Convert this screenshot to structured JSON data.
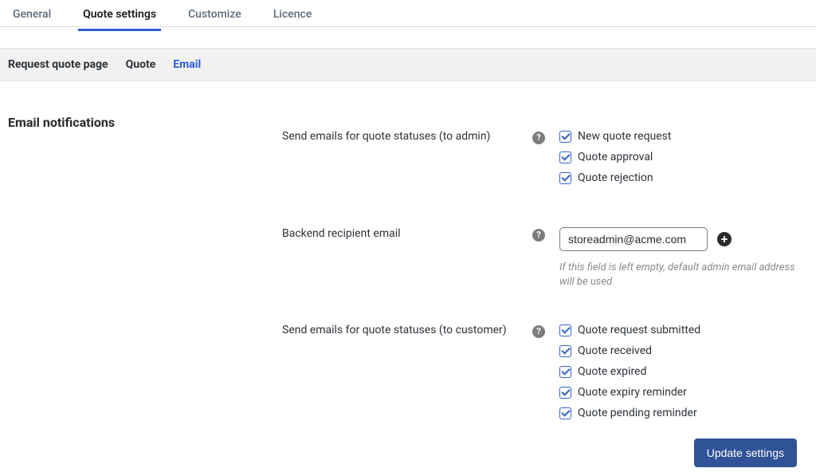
{
  "topTabs": {
    "general": "General",
    "quoteSettings": "Quote settings",
    "customize": "Customize",
    "licence": "Licence"
  },
  "subTabs": {
    "requestQuotePage": "Request quote page",
    "quote": "Quote",
    "email": "Email"
  },
  "section": {
    "title": "Email notifications"
  },
  "fields": {
    "adminEmails": {
      "label": "Send emails for quote statuses (to admin)",
      "options": {
        "newQuoteRequest": "New quote request",
        "quoteApproval": "Quote approval",
        "quoteRejection": "Quote rejection"
      }
    },
    "recipientEmail": {
      "label": "Backend recipient email",
      "value": "storeadmin@acme.com",
      "helper": "If this field is left empty, default admin email address will be used"
    },
    "customerEmails": {
      "label": "Send emails for quote statuses (to customer)",
      "options": {
        "quoteRequestSubmitted": "Quote request submitted",
        "quoteReceived": "Quote received",
        "quoteExpired": "Quote expired",
        "quoteExpiryReminder": "Quote expiry reminder",
        "quotePendingReminder": "Quote pending reminder"
      }
    }
  },
  "buttons": {
    "updateSettings": "Update settings"
  },
  "icons": {
    "help": "?",
    "plus": "+"
  }
}
